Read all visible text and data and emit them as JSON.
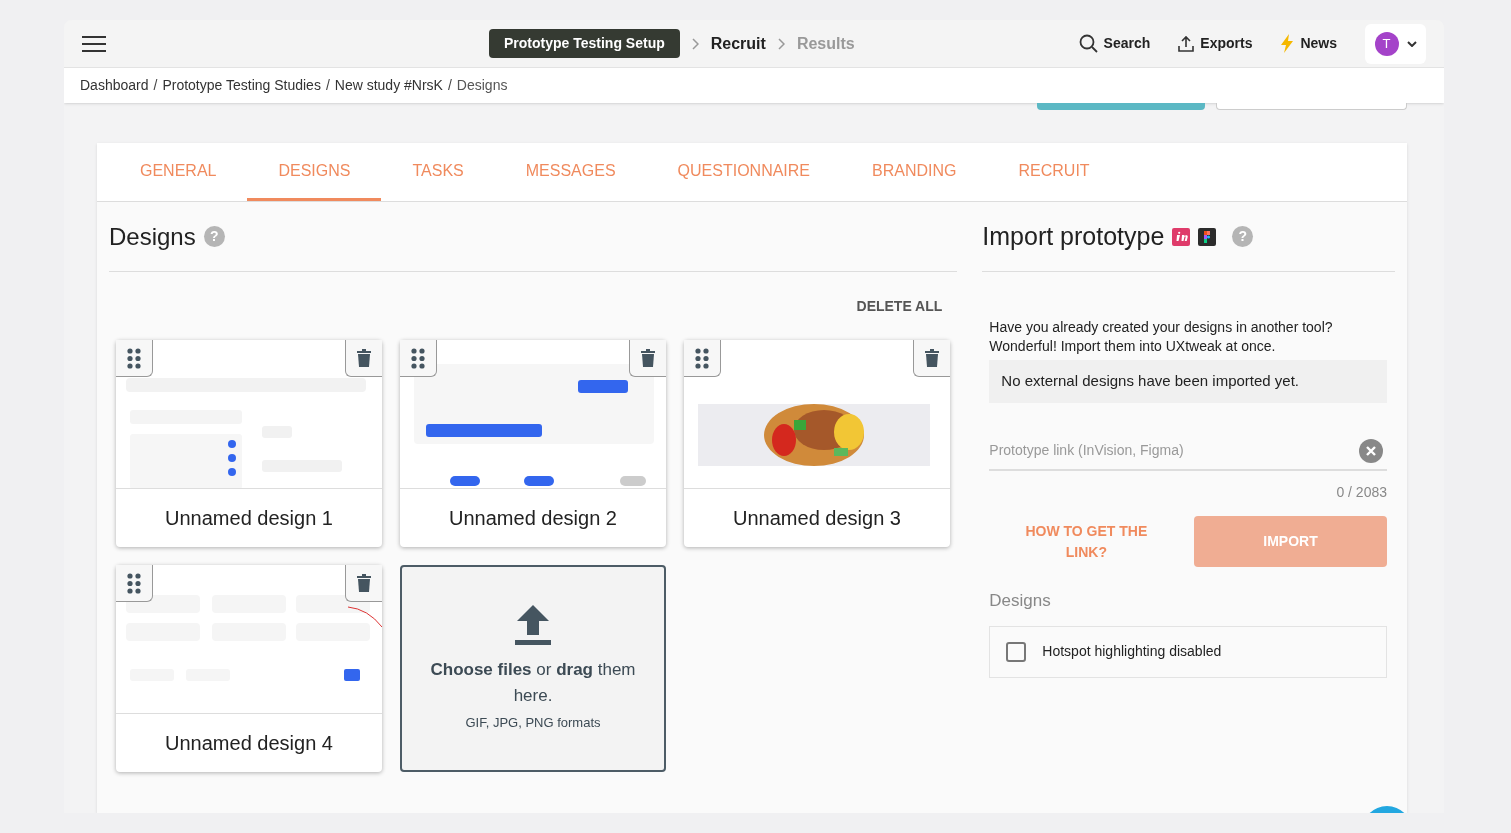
{
  "header": {
    "steps": [
      {
        "label": "Prototype Testing Setup",
        "selected": true,
        "disabled": false
      },
      {
        "label": "Recruit",
        "selected": false,
        "disabled": false
      },
      {
        "label": "Results",
        "selected": false,
        "disabled": true
      }
    ],
    "actions": [
      {
        "label": "Search",
        "kind": "search"
      },
      {
        "label": "Exports",
        "kind": "export"
      },
      {
        "label": "News",
        "kind": "news"
      }
    ],
    "avatar": "T"
  },
  "breadcrumb": {
    "separator": "/",
    "items": [
      "Dashboard",
      "Prototype Testing Studies",
      "New study #NrsK",
      "Designs"
    ]
  },
  "tabs": [
    {
      "label": "GENERAL",
      "selected": false
    },
    {
      "label": "DESIGNS",
      "selected": true
    },
    {
      "label": "TASKS",
      "selected": false
    },
    {
      "label": "MESSAGES",
      "selected": false
    },
    {
      "label": "QUESTIONNAIRE",
      "selected": false
    },
    {
      "label": "BRANDING",
      "selected": false
    },
    {
      "label": "RECRUIT",
      "selected": false
    }
  ],
  "designs": {
    "title": "Designs",
    "help_icon": "?",
    "delete_all": "DELETE ALL",
    "items": [
      {
        "name": "Unnamed design 1"
      },
      {
        "name": "Unnamed design 2"
      },
      {
        "name": "Unnamed design 3"
      },
      {
        "name": "Unnamed design 4"
      }
    ],
    "upload": {
      "main": "**Choose files** or **drag** them here.",
      "formats": "GIF, JPG, PNG formats"
    }
  },
  "import": {
    "title": "Import prototype",
    "help_icon": "?",
    "intro": "Have you already created your designs in another tool? Wonderful! Import them into UXtweak at once.",
    "notice": "No external designs have been imported yet.",
    "link_field": {
      "placeholder": "Prototype link (InVision, Figma)"
    },
    "counter": "0 / 2083",
    "help_link": "HOW TO GET THE LINK?",
    "import_button": {
      "label": "IMPORT",
      "disabled": true
    },
    "section": "Designs",
    "hotspot": {
      "label": "Hotspot highlighting disabled",
      "checked": false
    }
  }
}
